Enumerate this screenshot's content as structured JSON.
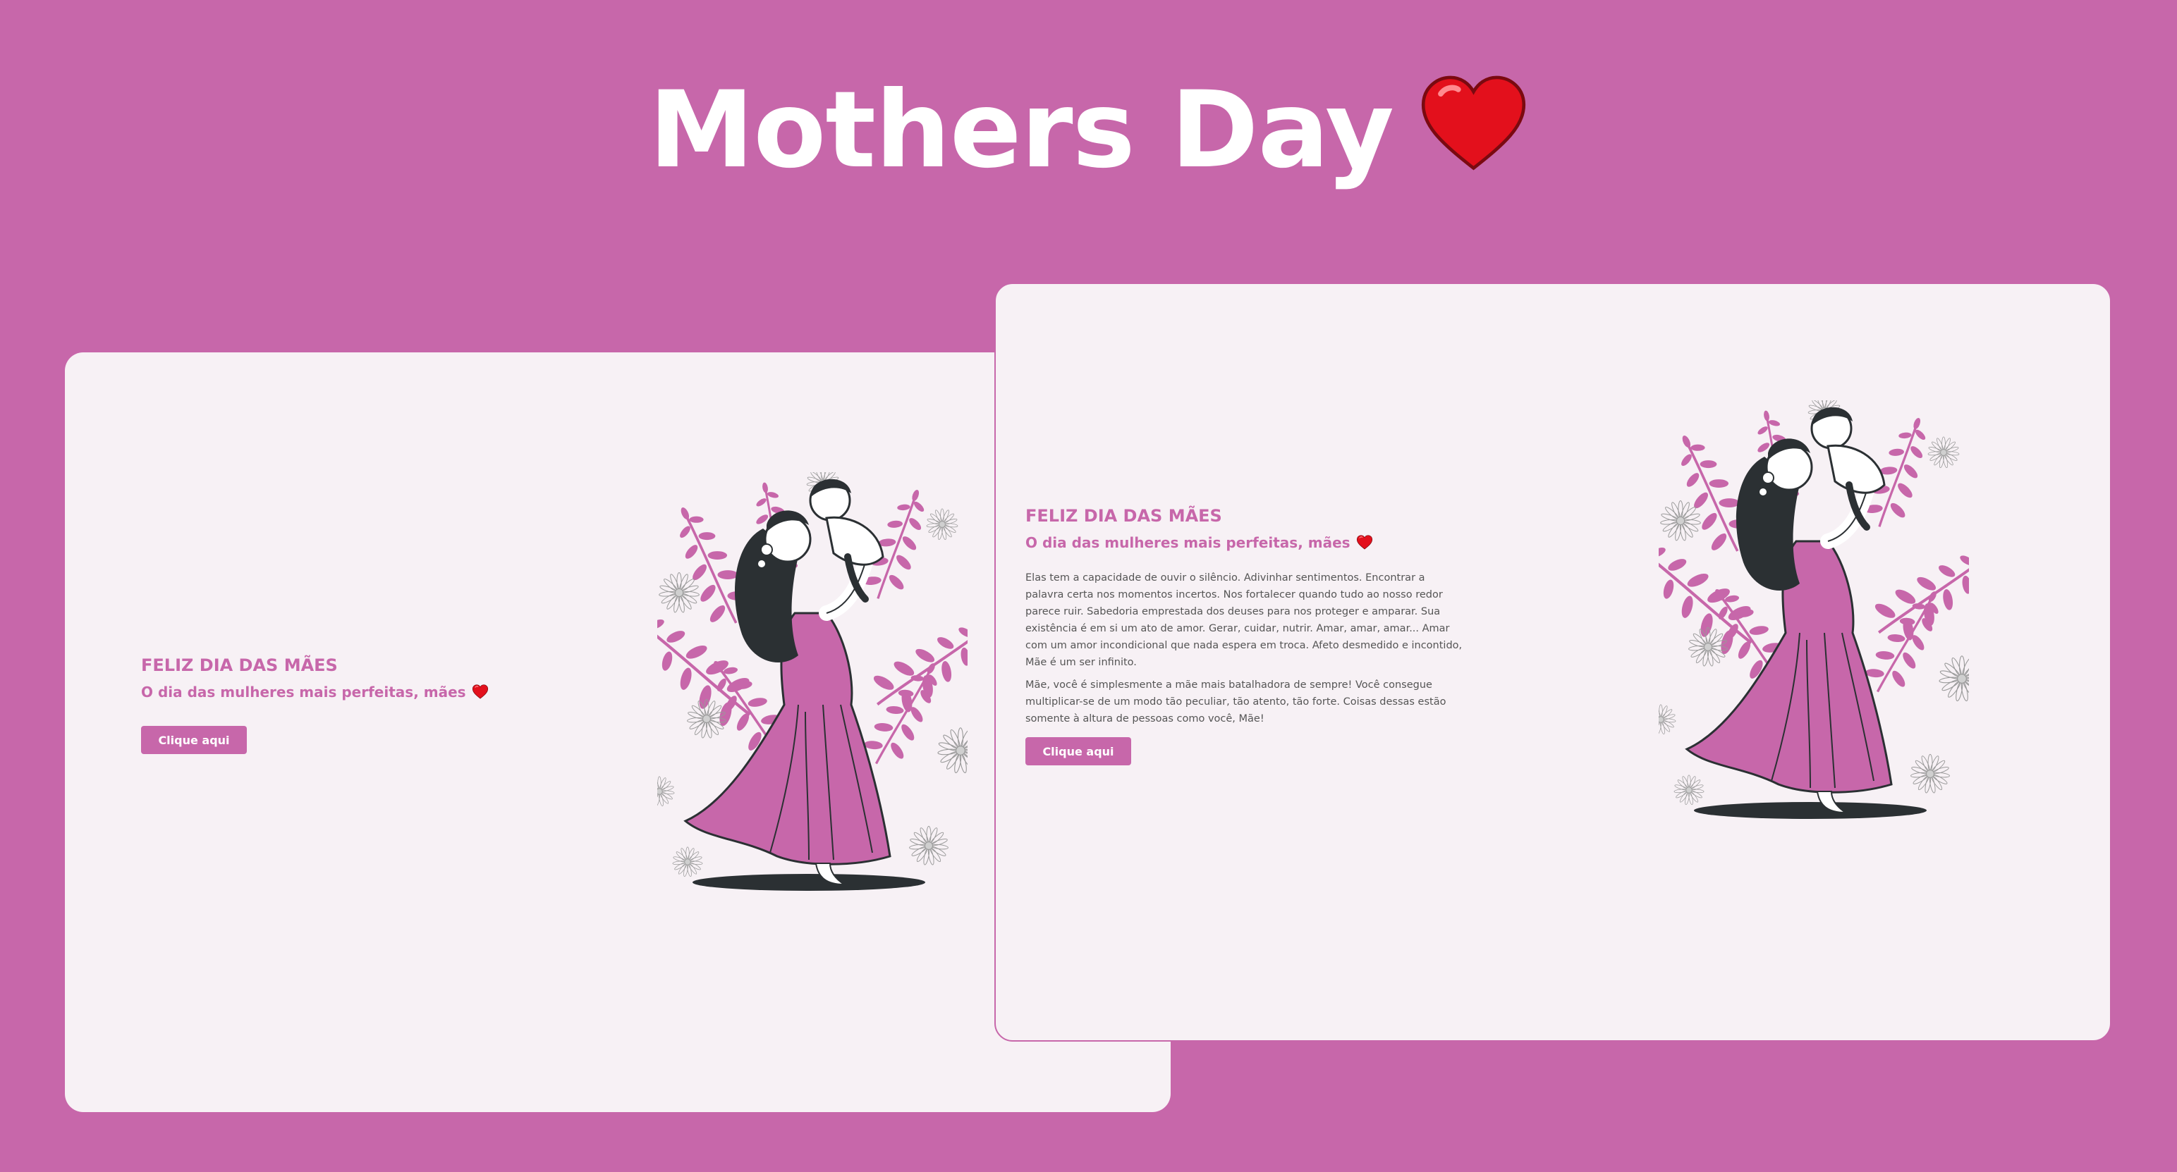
{
  "page": {
    "title": "Mothers Day",
    "title_emoji": "heart-emoji",
    "background": "#c767aa",
    "accent": "#c767aa"
  },
  "card_left": {
    "heading": "FELIZ DIA DAS MÃES",
    "subtitle": "O dia das mulheres mais perfeitas, mães",
    "button_label": "Clique aqui",
    "illustration": "mother-holding-child-illustration"
  },
  "card_right": {
    "heading": "FELIZ DIA DAS MÃES",
    "subtitle": "O dia das mulheres mais perfeitas, mães",
    "paragraph_1": "Elas tem a capacidade de ouvir o silêncio. Adivinhar sentimentos. Encontrar a palavra certa nos momentos incertos. Nos fortalecer quando tudo ao nosso redor parece ruir. Sabedoria emprestada dos deuses para nos proteger e amparar. Sua existência é em si um ato de amor. Gerar, cuidar, nutrir. Amar, amar, amar... Amar com um amor incondicional que nada espera em troca. Afeto desmedido e incontido, Mãe é um ser infinito.",
    "paragraph_2": "Mãe, você é simplesmente a mãe mais batalhadora de sempre! Você consegue multiplicar-se de um modo tão peculiar, tão atento, tão forte. Coisas dessas estão somente à altura de pessoas como você, Mãe!",
    "button_label": "Clique aqui",
    "illustration": "mother-holding-child-illustration"
  }
}
